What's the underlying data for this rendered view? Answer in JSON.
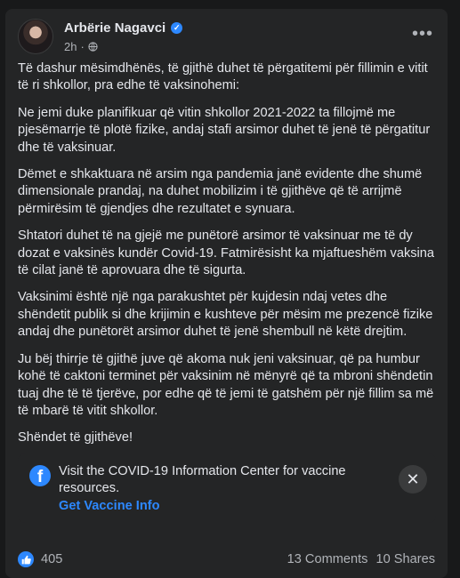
{
  "post": {
    "author": "Arbërie Nagavci",
    "time": "2h",
    "more_label": "•••",
    "paragraphs": [
      "Të dashur mësimdhënës, të gjithë duhet të përgatitemi për fillimin e vitit të ri shkollor, pra edhe të vaksinohemi:",
      "Ne jemi duke planifikuar që vitin shkollor 2021-2022 ta fillojmë me pjesëmarrje të plotë fizike, andaj stafi arsimor duhet të jenë të përgatitur dhe të vaksinuar.",
      "Dëmet e shkaktuara në arsim nga pandemia janë evidente dhe shumë dimensionale prandaj, na duhet mobilizim i të gjithëve që të arrijmë përmirësim të gjendjes dhe rezultatet e synuara.",
      "Shtatori duhet të na gjejë me punëtorë arsimor të vaksinuar me të dy dozat e vaksinës kundër Covid-19. Fatmirësisht ka mjaftueshëm vaksina të cilat janë të aprovuara dhe të sigurta.",
      "Vaksinimi është një nga parakushtet për kujdesin ndaj vetes dhe shëndetit publik si dhe krijimin e kushteve për mësim me prezencë fizike andaj dhe punëtorët arsimor duhet të jenë shembull në këtë drejtim.",
      "Ju bëj thirrje të gjithë juve që akoma nuk jeni vaksinuar, që pa humbur kohë të caktoni terminet për vaksinim në mënyrë që ta mbroni shëndetin tuaj dhe të të tjerëve, por edhe që të jemi të gatshëm për një fillim sa më të mbarë të vitit shkollor.",
      "Shëndet të gjithëve!"
    ]
  },
  "covid_info": {
    "text": "Visit the COVID-19 Information Center for vaccine resources.",
    "link": "Get Vaccine Info",
    "close_label": "✕"
  },
  "footer": {
    "reactions": "405",
    "comments": "13 Comments",
    "shares": "10 Shares"
  },
  "colors": {
    "background": "#18191a",
    "card": "#242526",
    "accent": "#2d88ff",
    "text": "#e4e6eb",
    "secondary_text": "#b0b3b8"
  }
}
